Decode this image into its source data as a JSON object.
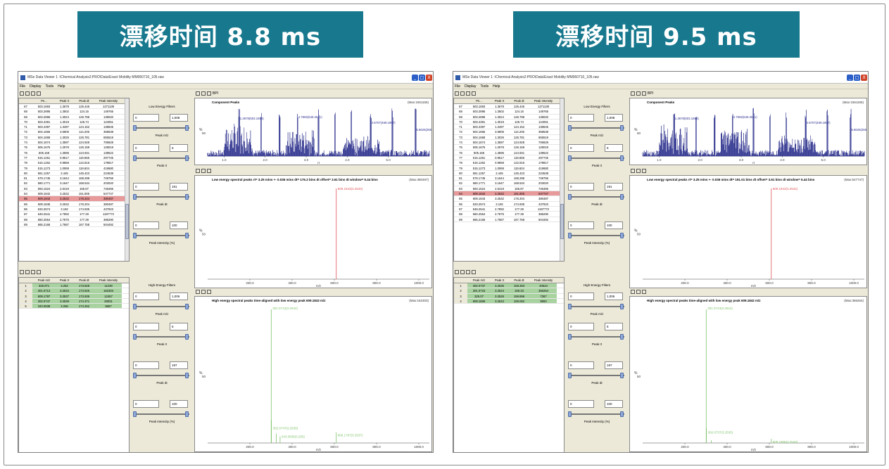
{
  "panels": [
    {
      "banner": "漂移时间 8.8 ms",
      "window_title": "MSe Data Viewer 1 :\\Chemical Analysis2:PRO\\Data\\Exact Mobility MM060710_105.raw",
      "menu": [
        "File",
        "Display",
        "Tools",
        "Help"
      ],
      "low_table": {
        "headers": [
          "Pe...",
          "Peak rt",
          "Peak dt",
          "Peak Intensity"
        ],
        "rows": [
          [
            "67",
            "503.1693",
            "1.3678",
            "125.446",
            "1271139"
          ],
          [
            "68",
            "503.2895",
            "1.3502",
            "124.15",
            "149765"
          ],
          [
            "69",
            "503.2896",
            "1.3024",
            "126.798",
            "139020"
          ],
          [
            "70",
            "503.4391",
            "1.3019",
            "126.74",
            "124051"
          ],
          [
            "71",
            "503.4397",
            "1.3497",
            "124.152",
            "138645"
          ],
          [
            "72",
            "504.1665",
            "3.5805",
            "114.205",
            "358538"
          ],
          [
            "73",
            "504.1668",
            "1.3026",
            "126.781",
            "655519"
          ],
          [
            "74",
            "504.1674",
            "1.3597",
            "124.928",
            "706629"
          ],
          [
            "75",
            "505.1675",
            "1.2978",
            "126.159",
            "128019"
          ],
          [
            "76",
            "505.168",
            "1.3596",
            "124.931",
            "139522"
          ],
          [
            "77",
            "515.1261",
            "0.9517",
            "119.658",
            "297745"
          ],
          [
            "78",
            "515.1262",
            "0.9858",
            "122.816",
            "178817"
          ],
          [
            "79",
            "515.1273",
            "1.0069",
            "119.604",
            "419680"
          ],
          [
            "80",
            "561.1257",
            "2.445",
            "145.423",
            "224538"
          ],
          [
            "81",
            "579.1745",
            "3.1644",
            "168.298",
            "749756"
          ],
          [
            "82",
            "580.1771",
            "3.1647",
            "168.534",
            "203020"
          ],
          [
            "83",
            "593.1524",
            "2.6419",
            "166.87",
            "746466"
          ],
          [
            "84",
            "609.1842",
            "3.2532",
            "161.805",
            "547747"
          ],
          [
            "85",
            "609.1843",
            "3.2532",
            "176.204",
            "380487"
          ],
          [
            "86",
            "609.1845",
            "3.2532",
            "176.204",
            "380487"
          ],
          [
            "86",
            "633.2574",
            "3.192",
            "174.935",
            "437923"
          ],
          [
            "87",
            "649.2541",
            "2.7892",
            "177.29",
            "1197772"
          ],
          [
            "88",
            "650.2554",
            "2.7875",
            "177.39",
            "386290"
          ],
          [
            "89",
            "665.2166",
            "1.7687",
            "167.758",
            "504492"
          ]
        ],
        "selected_index": 18
      },
      "high_table": {
        "headers": [
          "Peak m/z",
          "Peak rt",
          "Peak dt",
          "Peak Intensity"
        ],
        "rows": [
          [
            "1",
            "325.071",
            "3.252",
            "173.828",
            "11239"
          ],
          [
            "2",
            "301.0713",
            "3.2534",
            "173.925",
            "162303"
          ],
          [
            "3",
            "609.1797",
            "3.2537",
            "173.936",
            "12457"
          ],
          [
            "4",
            "302.0747",
            "3.2539",
            "174.371",
            "28031"
          ],
          [
            "5",
            "343.0838",
            "3.256",
            "174.252",
            "8687"
          ]
        ]
      },
      "low_filters": {
        "title": "Low Energy Filters",
        "groups": [
          {
            "label": "Peak m/z",
            "min": "0",
            "max": "1,008"
          },
          {
            "label": "Peak rt",
            "min": "0",
            "max": "6"
          },
          {
            "label": "Peak dt",
            "min": "0",
            "max": "191"
          },
          {
            "label": "Peak Intensity (%)",
            "min": "0",
            "max": "100"
          }
        ]
      },
      "high_filters": {
        "title": "High Energy Filters",
        "groups": [
          {
            "label": "Peak m/z",
            "min": "0",
            "max": "1,006"
          },
          {
            "label": "Peak rt",
            "min": "0",
            "max": "6"
          },
          {
            "label": "Peak dt",
            "min": "0",
            "max": "197"
          },
          {
            "label": "Peak Intensity (%)",
            "min": "0",
            "max": "100"
          }
        ]
      },
      "plot1": {
        "tool": "BPI",
        "title": "Component Peaks",
        "max": "(Max:1551155)",
        "xlabel": "rt",
        "ylabel": "%",
        "ytick": "50",
        "xticks": [
          "1.0",
          "2.0",
          "3.0",
          "4.0",
          "5.0"
        ],
        "labels": [
          "1.3678(503.1693)",
          "2.7892(649.2541)",
          "4.5707(469.1867)",
          "5.6626(265"
        ]
      },
      "plot2": {
        "title": "Low energy spectral peaks rt= 3.25 mins +- 0.036 mins dt= 176.2 bins dt offset= 3.61 bins dt window= 5.44 bins",
        "max": "(Max:380487)",
        "xlabel": "m/z",
        "ylabel": "%",
        "ytick": "50",
        "xticks": [
          "200.0",
          "400.0",
          "600.0",
          "800.0",
          "1000.0"
        ],
        "peak_label": "609.1843(3.2532)"
      },
      "plot3": {
        "title": "High energy spectral peaks time-aligned with low energy peak 609.1843 m/z",
        "max": "(Max:162303)",
        "xlabel": "m/z",
        "ylabel": "%",
        "ytick": "50",
        "xticks": [
          "200.0",
          "400.0",
          "600.0",
          "800.0",
          "1000.0"
        ],
        "labels": [
          "301.0713(3.2534)",
          "302.0747(3.2539)",
          "343.0838(3.256)",
          "609.1797(3.2537)"
        ]
      }
    },
    {
      "banner": "漂移时间 9.5 ms",
      "window_title": "MSe Data Viewer 1 :\\Chemical Analysis2:PRO\\Data\\Exact Mobility MM060710_105.raw",
      "menu": [
        "File",
        "Display",
        "Tools",
        "Help"
      ],
      "low_table": {
        "headers": [
          "Pe...",
          "Peak rt",
          "Peak dt",
          "Peak Intensity"
        ],
        "rows": [
          [
            "67",
            "503.1693",
            "1.3678",
            "125.446",
            "1271139"
          ],
          [
            "68",
            "503.2895",
            "1.3502",
            "124.15",
            "149765"
          ],
          [
            "69",
            "503.2896",
            "1.3024",
            "126.798",
            "139020"
          ],
          [
            "70",
            "503.4391",
            "1.3019",
            "126.74",
            "124051"
          ],
          [
            "71",
            "503.4397",
            "1.3497",
            "124.152",
            "138645"
          ],
          [
            "72",
            "504.1665",
            "3.5805",
            "114.205",
            "358538"
          ],
          [
            "73",
            "504.1668",
            "1.3026",
            "126.781",
            "655519"
          ],
          [
            "74",
            "504.1674",
            "1.3597",
            "124.928",
            "706629"
          ],
          [
            "75",
            "505.1675",
            "1.2978",
            "126.159",
            "128019"
          ],
          [
            "76",
            "505.168",
            "1.3596",
            "124.931",
            "139522"
          ],
          [
            "77",
            "515.1261",
            "0.9517",
            "119.658",
            "297745"
          ],
          [
            "78",
            "515.1262",
            "0.9858",
            "122.816",
            "178817"
          ],
          [
            "79",
            "515.1273",
            "1.0069",
            "119.604",
            "419680"
          ],
          [
            "80",
            "561.1257",
            "2.445",
            "145.423",
            "224538"
          ],
          [
            "81",
            "579.1745",
            "3.1644",
            "168.298",
            "749756"
          ],
          [
            "82",
            "580.1771",
            "3.1647",
            "168.534",
            "203020"
          ],
          [
            "83",
            "593.1524",
            "2.6419",
            "166.87",
            "746466"
          ],
          [
            "84",
            "609.1842",
            "3.2532",
            "161.805",
            "547747"
          ],
          [
            "85",
            "609.1843",
            "3.2532",
            "176.204",
            "380487"
          ],
          [
            "86",
            "633.2574",
            "3.192",
            "174.935",
            "437923"
          ],
          [
            "87",
            "649.2541",
            "2.7892",
            "177.29",
            "1197772"
          ],
          [
            "88",
            "650.2554",
            "2.7875",
            "177.39",
            "386290"
          ],
          [
            "89",
            "665.2166",
            "1.7687",
            "167.758",
            "504492"
          ]
        ],
        "selected_index": 17
      },
      "high_table": {
        "headers": [
          "Peak m/z",
          "Peak rt",
          "Peak dt",
          "Peak Intensity"
        ],
        "rows": [
          [
            "1",
            "302.0737",
            "3.2535",
            "159.283",
            "40543"
          ],
          [
            "2",
            "301.0723",
            "3.2524",
            "159.33",
            "356264"
          ],
          [
            "3",
            "325.07",
            "3.2526",
            "159.896",
            "7367"
          ],
          [
            "4",
            "609.1806",
            "3.2543",
            "159.092",
            "9993"
          ]
        ]
      },
      "low_filters": {
        "title": "Low Energy Filters",
        "groups": [
          {
            "label": "Peak m/z",
            "min": "0",
            "max": "1,008"
          },
          {
            "label": "Peak rt",
            "min": "0",
            "max": "6"
          },
          {
            "label": "Peak dt",
            "min": "0",
            "max": "191"
          },
          {
            "label": "Peak Intensity (%)",
            "min": "0",
            "max": "100"
          }
        ]
      },
      "high_filters": {
        "title": "High Energy Filters",
        "groups": [
          {
            "label": "Peak m/z",
            "min": "0",
            "max": "1,006"
          },
          {
            "label": "Peak rt",
            "min": "0",
            "max": "6"
          },
          {
            "label": "Peak dt",
            "min": "0",
            "max": "197"
          },
          {
            "label": "Peak Intensity (%)",
            "min": "0",
            "max": "100"
          }
        ]
      },
      "plot1": {
        "tool": "BPI",
        "title": "Component Peaks",
        "max": "(Max:1551155)",
        "xlabel": "rt",
        "ylabel": "%",
        "ytick": "50",
        "xticks": [
          "1.0",
          "2.0",
          "3.0",
          "4.0",
          "5.0"
        ],
        "labels": [
          "1.3678(503.1693)",
          "2.7892(649.2541)",
          "4.5707(469.1867)",
          "5.6626(265"
        ]
      },
      "plot2": {
        "title": "Low energy spectral peaks rt= 3.25 mins +- 0.036 mins dt= 191.01 bins dt offset= 3.61 bins dt window= 5.44 bins",
        "max": "(Max:547747)",
        "xlabel": "m/z",
        "ylabel": "%",
        "ytick": "50",
        "xticks": [
          "200.0",
          "400.0",
          "600.0",
          "800.0",
          "1000.0"
        ],
        "peak_label": "609.1842(3.2532)"
      },
      "plot3": {
        "title": "High energy spectral peaks time-aligned with low energy peak 609.1842 m/z",
        "max": "(Max:356264)",
        "xlabel": "m/z",
        "ylabel": "%",
        "ytick": "50",
        "xticks": [
          "200.0",
          "400.0",
          "600.0",
          "800.0",
          "1000.0"
        ],
        "labels": [
          "301.0723(3.2524)",
          "302.0737(3.2535)",
          "609.1806(3.2543)"
        ]
      }
    }
  ],
  "chart_data": [
    {
      "type": "bar",
      "title": "Low energy spectral peaks (8.8 ms)",
      "xlabel": "m/z",
      "xlim": [
        0,
        1050
      ],
      "x": [
        609.1843
      ],
      "values": [
        100
      ]
    },
    {
      "type": "bar",
      "title": "High energy spectral peaks (8.8 ms)",
      "xlabel": "m/z",
      "xlim": [
        0,
        1050
      ],
      "x": [
        301.0713,
        302.0747,
        325.071,
        343.0838,
        609.1797
      ],
      "values": [
        100,
        17,
        7,
        5,
        8
      ]
    },
    {
      "type": "bar",
      "title": "Low energy spectral peaks (9.5 ms)",
      "xlabel": "m/z",
      "xlim": [
        0,
        1050
      ],
      "x": [
        609.1842
      ],
      "values": [
        100
      ]
    },
    {
      "type": "bar",
      "title": "High energy spectral peaks (9.5 ms)",
      "xlabel": "m/z",
      "xlim": [
        0,
        1050
      ],
      "x": [
        301.0723,
        302.0737,
        325.07,
        609.1806
      ],
      "values": [
        100,
        11,
        2,
        3
      ]
    }
  ],
  "colors": {
    "banner": "#17788e",
    "window_bg": "#ece9d8",
    "selected_row": "#e8999a",
    "green_row": "#a8d3a0",
    "bpi_trace": "#2b2f8c",
    "low_peak": "#e0575c",
    "high_peak": "#7fc36b"
  }
}
